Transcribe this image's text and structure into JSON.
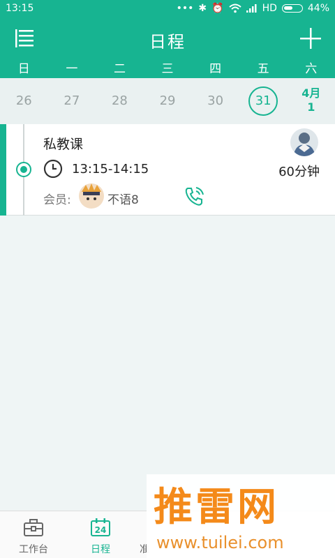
{
  "status_bar": {
    "time": "13:15",
    "network": "HD",
    "battery": "44%",
    "icons": [
      "dots-icon",
      "bluetooth-icon",
      "alarm-icon",
      "wifi-icon",
      "signal-icon",
      "battery-icon"
    ]
  },
  "app_bar": {
    "title": "日程"
  },
  "calendar": {
    "weekdays": [
      "日",
      "一",
      "二",
      "三",
      "四",
      "五",
      "六"
    ],
    "dates": [
      {
        "day": "26"
      },
      {
        "day": "27"
      },
      {
        "day": "28"
      },
      {
        "day": "29"
      },
      {
        "day": "30"
      },
      {
        "day": "31",
        "selected": true
      },
      {
        "month": "4月",
        "day": "1"
      }
    ]
  },
  "schedule": {
    "course": "私教课",
    "time_range": "13:15-14:15",
    "duration": "60分钟",
    "member_label": "会员:",
    "member_name": "不语8"
  },
  "bottom_nav": [
    {
      "label": "工作台",
      "icon": "briefcase-icon"
    },
    {
      "label": "日程",
      "icon": "calendar-24-icon",
      "active": true,
      "badge": "24"
    },
    {
      "label": "准",
      "icon": "partial-icon"
    }
  ],
  "watermark": {
    "brand": "推雷网",
    "url": "www.tuilei.com"
  },
  "colors": {
    "primary": "#17b491",
    "background": "#eff5f5",
    "watermark": "#f48a1a"
  }
}
